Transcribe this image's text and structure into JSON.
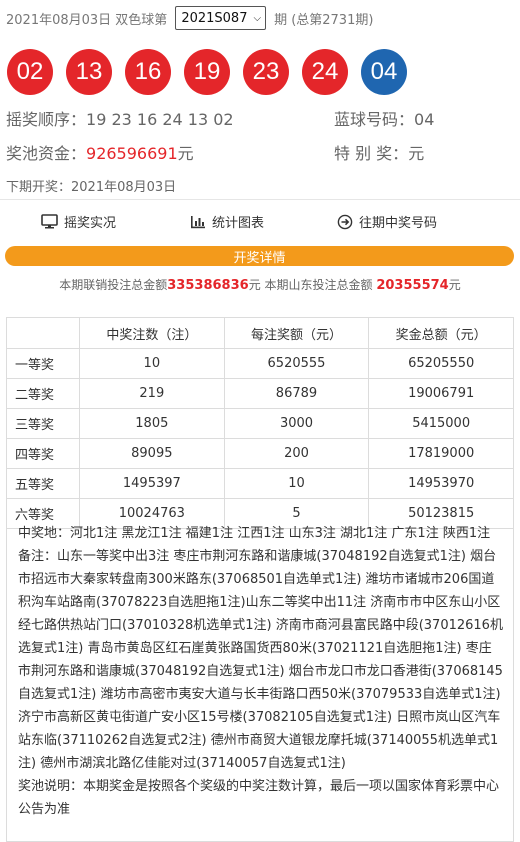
{
  "header": {
    "date_prefix": "2021年08月03日 双色球第",
    "issue_selected": "2021S087",
    "issue_suffix": "期 (总第2731期)"
  },
  "balls": {
    "red": [
      "02",
      "13",
      "16",
      "19",
      "23",
      "24"
    ],
    "blue": "04"
  },
  "draw_info": {
    "order_label": "摇奖顺序：",
    "order_value": "19 23 16 24 13 02",
    "blue_label": "蓝球号码：",
    "blue_value": "04",
    "pool_label": "奖池资金：",
    "pool_value": "926596691",
    "pool_unit": "元",
    "special_label": "特 别 奖：",
    "special_value": "元",
    "next_open": "下期开奖：2021年08月03日"
  },
  "links": {
    "live": "摇奖实况",
    "charts": "统计图表",
    "history": "往期中奖号码"
  },
  "details_bar": "开奖详情",
  "sales": {
    "prefix": "本期联销投注总金额",
    "total": "335386836",
    "middle": "元 本期山东投注总金额",
    "shandong": "20355574",
    "unit": "元"
  },
  "table": {
    "headers": [
      "",
      "中奖注数（注）",
      "每注奖额（元）",
      "奖金总额（元）"
    ],
    "rows": [
      [
        "一等奖",
        "10",
        "6520555",
        "65205550"
      ],
      [
        "二等奖",
        "219",
        "86789",
        "19006791"
      ],
      [
        "三等奖",
        "1805",
        "3000",
        "5415000"
      ],
      [
        "四等奖",
        "89095",
        "200",
        "17819000"
      ],
      [
        "五等奖",
        "1495397",
        "10",
        "14953970"
      ],
      [
        "六等奖",
        "10024763",
        "5",
        "50123815"
      ]
    ]
  },
  "notes": {
    "locations": "中奖地：河北1注 黑龙江1注 福建1注 江西1注 山东3注 湖北1注 广东1注 陕西1注",
    "remark": "备注：山东一等奖中出3注 枣庄市荆河东路和谐康城(37048192自选复式1注) 烟台市招远市大秦家转盘南300米路东(37068501自选单式1注) 潍坊市诸城市206国道积沟车站路南(37078223自选胆拖1注)山东二等奖中出11注 济南市市中区东山小区经七路供热站门口(37010328机选单式1注) 济南市商河县富民路中段(37012616机选复式1注) 青岛市黄岛区红石崖黄张路国货西80米(37021121自选胆拖1注) 枣庄市荆河东路和谐康城(37048192自选复式1注) 烟台市龙口市龙口香港街(37068145自选复式1注) 潍坊市高密市夷安大道与长丰街路口西50米(37079533自选单式1注) 济宁市高新区黄屯街道广安小区15号楼(37082105自选复式1注) 日照市岚山区汽车站东临(37110262自选复式2注) 德州市商贸大道银龙摩托城(37140055机选单式1注) 德州市湖滨北路亿佳能对过(37140057自选复式1注)",
    "footer": "奖池说明：本期奖金是按照各个奖级的中奖注数计算，最后一项以国家体育彩票中心公告为准"
  }
}
